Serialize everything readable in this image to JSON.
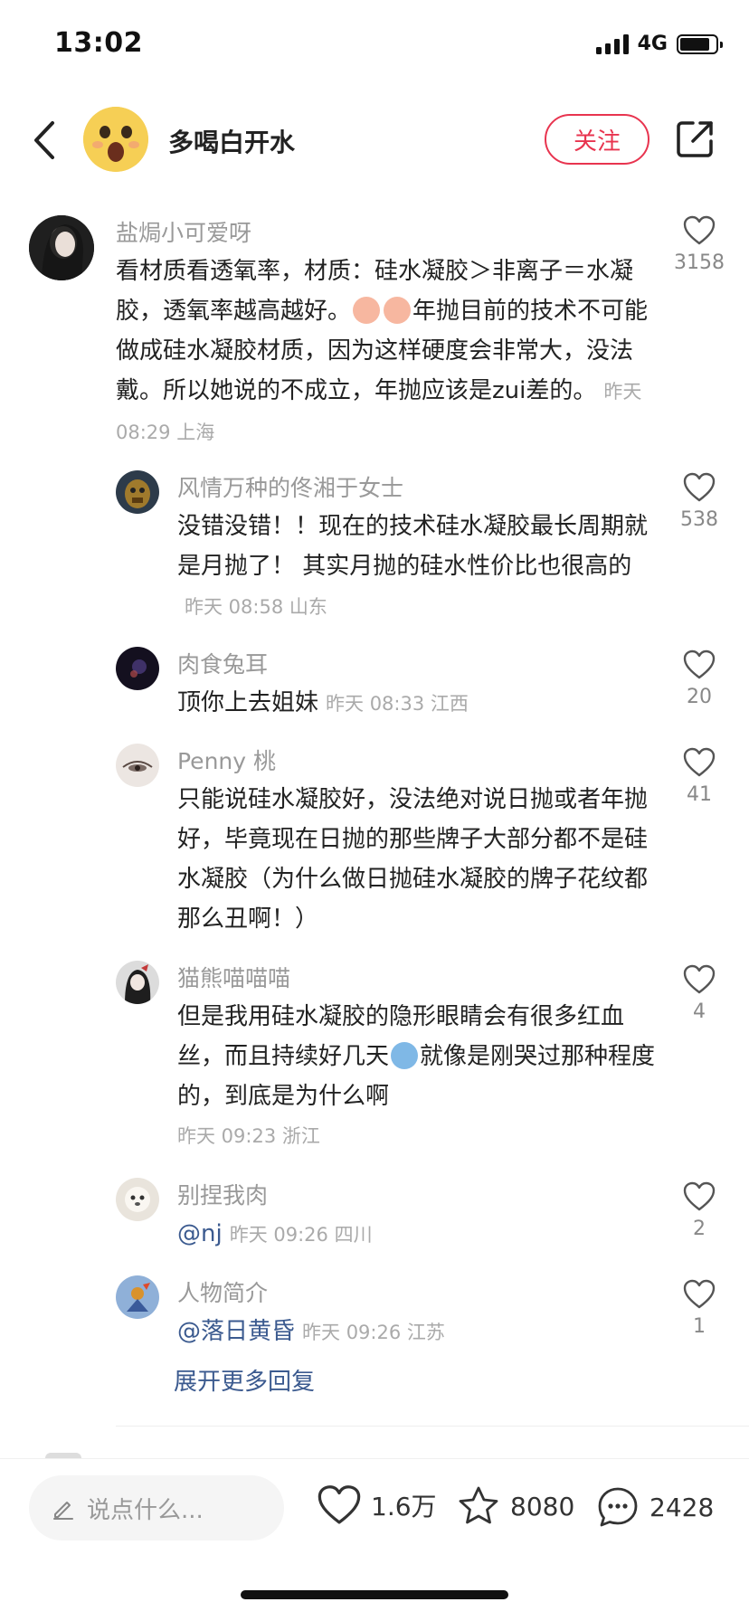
{
  "status_bar": {
    "time": "13:02",
    "network": "4G"
  },
  "header": {
    "author_name": "多喝白开水",
    "follow_label": "关注"
  },
  "comments": [
    {
      "username": "盐焗小可爱呀",
      "text_a": "看材质看透氧率，材质：硅水凝胶＞非离子＝水凝胶，透氧率越高越好。",
      "text_b": "年抛目前的技术不可能做成硅水凝胶材质，因为这样硬度会非常大，没法戴。所以她说的不成立，年抛应该是zui差的。",
      "meta": "昨天 08:29 上海",
      "likes": "3158"
    },
    {
      "username": "风情万种的佟湘于女士",
      "text": "没错没错！！现在的技术硅水凝胶最长周期就是月抛了！ 其实月抛的硅水性价比也很高的",
      "meta": "昨天 08:58 山东",
      "likes": "538"
    },
    {
      "username": "肉食兔耳",
      "text": "顶你上去姐妹",
      "meta": "昨天 08:33 江西",
      "likes": "20"
    },
    {
      "username": "Penny 桃",
      "text": "只能说硅水凝胶好，没法绝对说日抛或者年抛好，毕竟现在日抛的那些牌子大部分都不是硅水凝胶（为什么做日抛硅水凝胶的牌子花纹都那么丑啊！）",
      "meta": "",
      "likes": "41"
    },
    {
      "username": "猫熊喵喵喵",
      "text_a": "但是我用硅水凝胶的隐形眼睛会有很多红血丝，而且持续好几天",
      "text_b": "就像是刚哭过那种程度的，到底是为什么啊",
      "meta": "昨天 09:23 浙江",
      "likes": "4"
    },
    {
      "username": "别捏我肉",
      "mention": "@nj",
      "meta": "昨天 09:26 四川",
      "likes": "2"
    },
    {
      "username": "人物简介",
      "mention": "@落日黄昏",
      "meta": "昨天 09:26 江苏",
      "likes": "1"
    }
  ],
  "expand_more_label": "展开更多回复",
  "bottom_bar": {
    "input_placeholder": "说点什么...",
    "likes": "1.6万",
    "favorites": "8080",
    "comments": "2428"
  },
  "colors": {
    "accent": "#e8344f",
    "link": "#3b5a8f"
  },
  "icons": [
    "back-icon",
    "share-icon",
    "heart-icon",
    "star-icon",
    "chat-icon",
    "pencil-icon"
  ]
}
